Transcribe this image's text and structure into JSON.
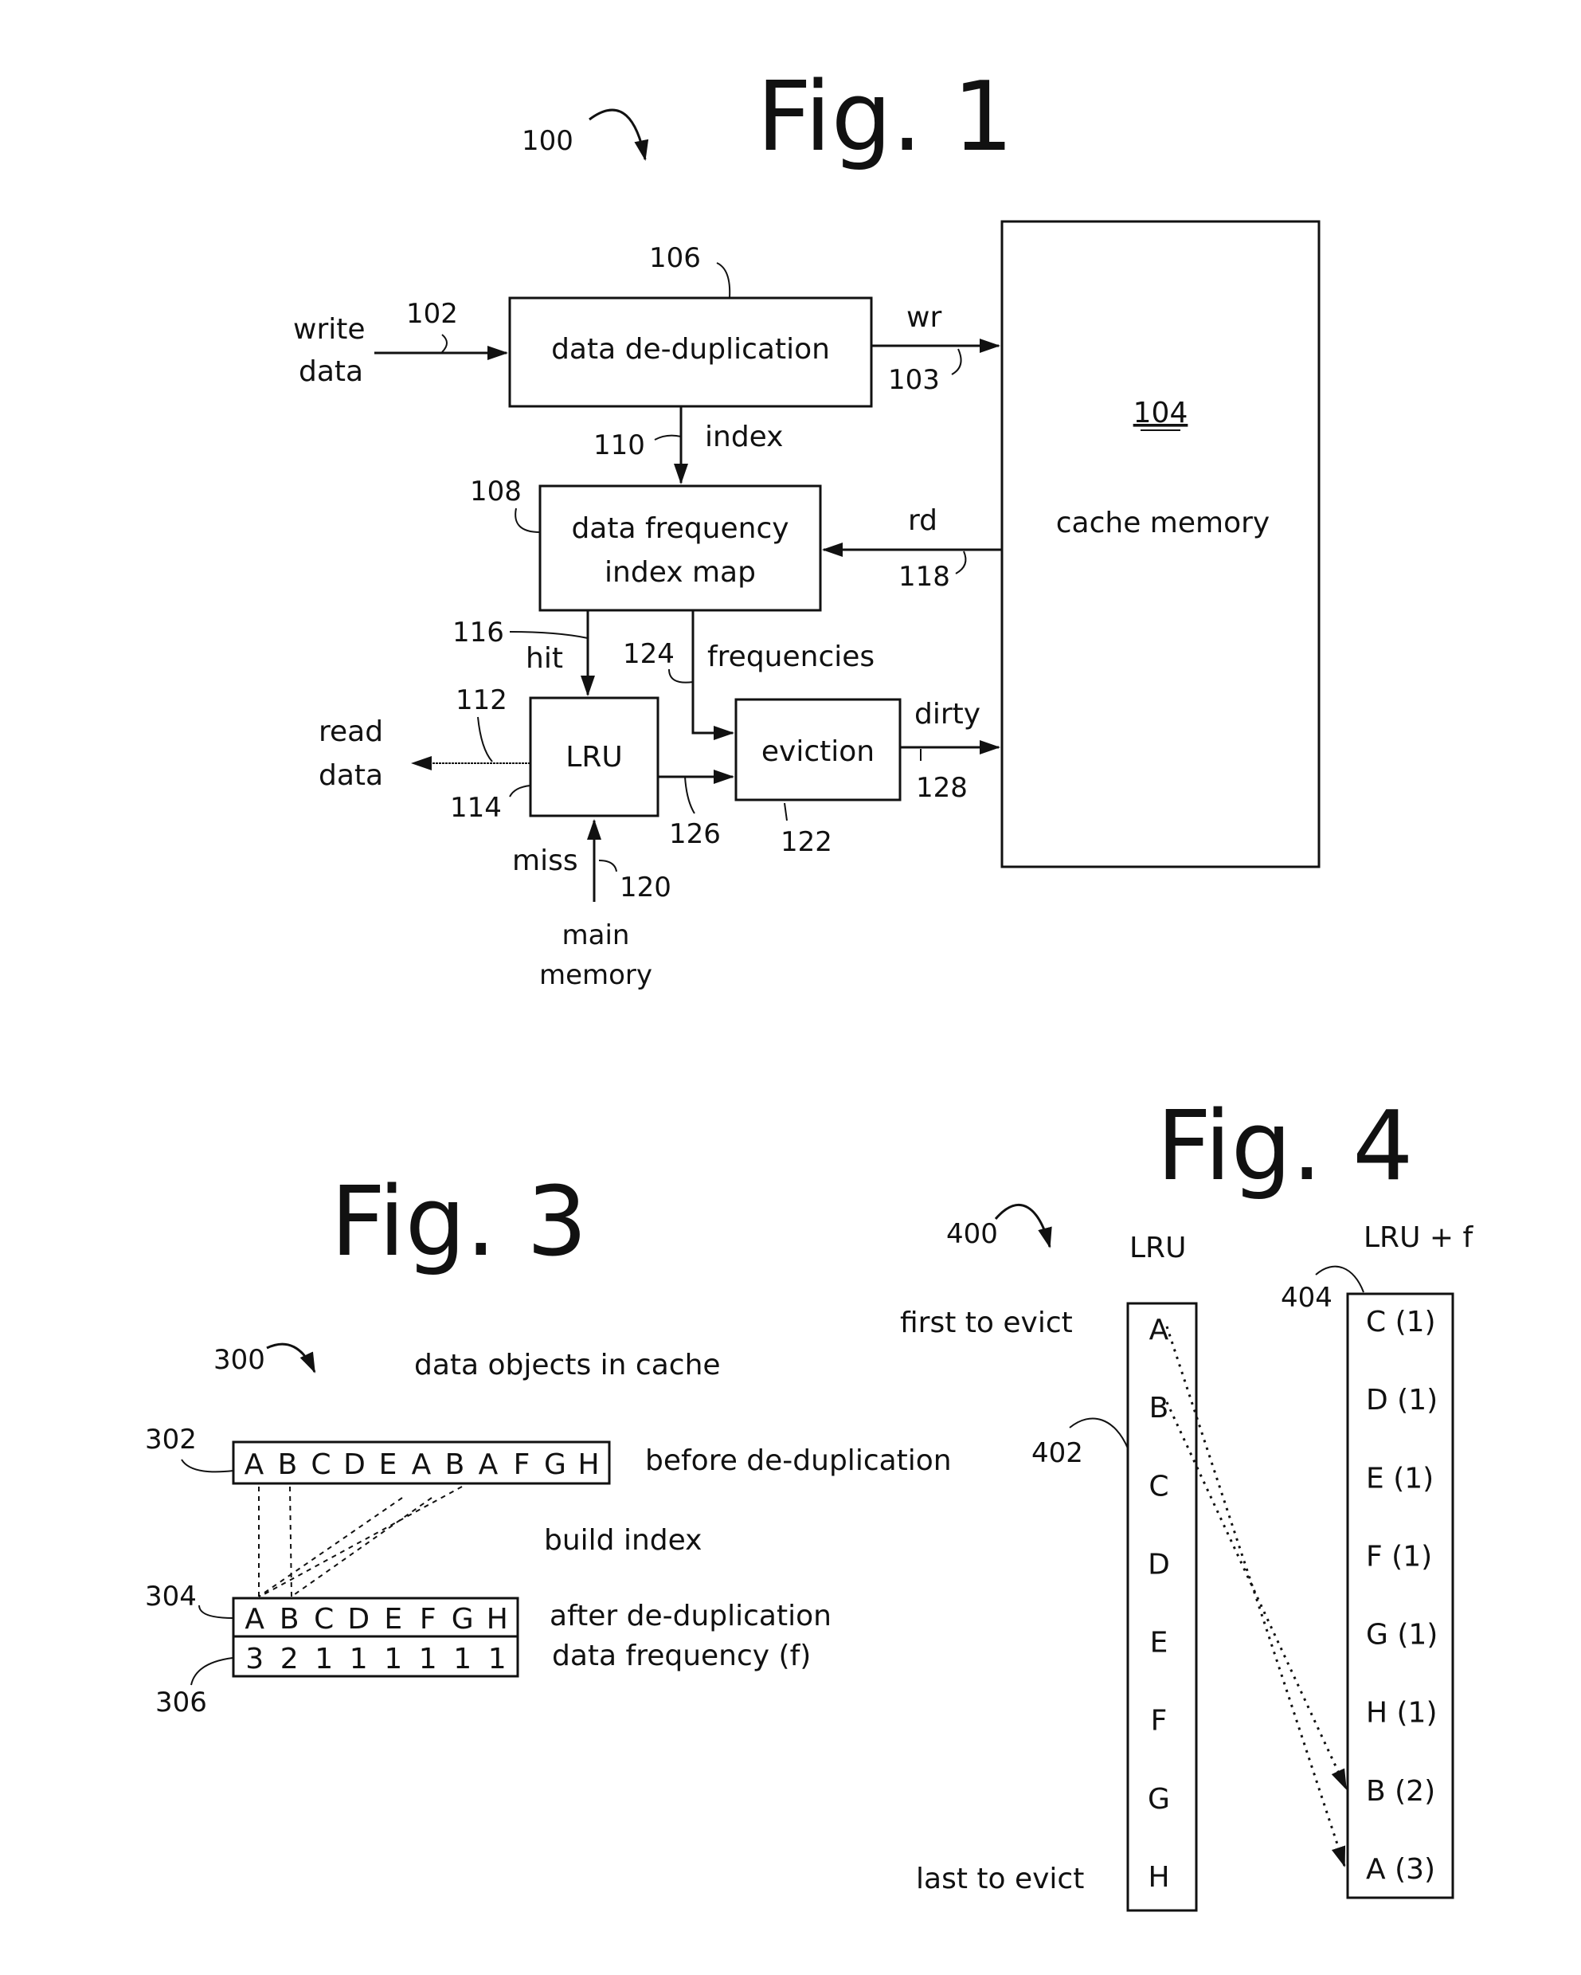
{
  "fig1": {
    "title": "Fig. 1",
    "ref": "100",
    "write_data": [
      "write",
      "data"
    ],
    "ref_write": "102",
    "dedup": {
      "ref": "106",
      "label": "data de-duplication"
    },
    "wr": "wr",
    "ref_wr": "103",
    "cache": {
      "ref": "104",
      "label": "cache memory"
    },
    "index": "index",
    "ref_index": "110",
    "freqmap": {
      "ref": "108",
      "label": [
        "data frequency",
        "index map"
      ]
    },
    "rd": "rd",
    "ref_rd": "118",
    "hit": "hit",
    "ref_hit": "116",
    "frequencies": "frequencies",
    "ref_frequencies": "124",
    "lru": {
      "label": "LRU",
      "ref_top": "112",
      "ref_bottom": "114"
    },
    "read_data": [
      "read",
      "data"
    ],
    "eviction": {
      "label": "eviction",
      "ref": "122"
    },
    "dirty": "dirty",
    "ref_dirty": "128",
    "ref_lru_evict": "126",
    "miss": "miss",
    "ref_miss": "120",
    "main_memory": [
      "main",
      "memory"
    ]
  },
  "fig3": {
    "title": "Fig. 3",
    "ref": "300",
    "heading": "data objects in cache",
    "before": {
      "ref": "302",
      "label": "before de-duplication",
      "cells": [
        "A",
        "B",
        "C",
        "D",
        "E",
        "A",
        "B",
        "A",
        "F",
        "G",
        "H"
      ]
    },
    "build_index": "build index",
    "after": {
      "ref": "304",
      "label": "after de-duplication",
      "cells": [
        "A",
        "B",
        "C",
        "D",
        "E",
        "F",
        "G",
        "H"
      ]
    },
    "frequency": {
      "ref": "306",
      "label": "data frequency (f)",
      "cells": [
        "3",
        "2",
        "1",
        "1",
        "1",
        "1",
        "1",
        "1"
      ]
    }
  },
  "fig4": {
    "title": "Fig. 4",
    "ref": "400",
    "first_to_evict": "first to evict",
    "last_to_evict": "last to evict",
    "lru": {
      "ref": "402",
      "heading": "LRU",
      "items": [
        "A",
        "B",
        "C",
        "D",
        "E",
        "F",
        "G",
        "H"
      ]
    },
    "lru_f": {
      "ref": "404",
      "heading": "LRU + f",
      "items": [
        "C (1)",
        "D (1)",
        "E (1)",
        "F (1)",
        "G (1)",
        "H (1)",
        "B (2)",
        "A (3)"
      ]
    }
  }
}
